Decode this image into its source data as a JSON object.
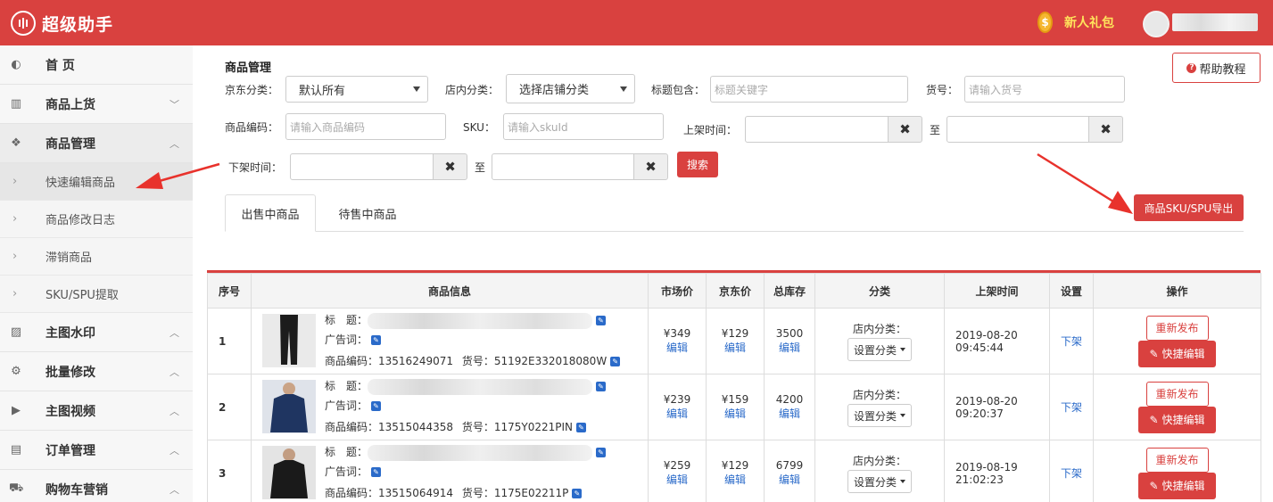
{
  "header": {
    "app_title": "超级助手",
    "gift_label": "新人礼包",
    "coin_symbol": "$"
  },
  "sidebar": {
    "items": [
      {
        "label": "首 页",
        "icon": "dashboard-icon",
        "glyph": "◐"
      },
      {
        "label": "商品上货",
        "icon": "columns-icon",
        "glyph": "▥"
      },
      {
        "label": "商品管理",
        "icon": "dropbox-icon",
        "glyph": "❖"
      },
      {
        "label": "主图水印",
        "icon": "image-icon",
        "glyph": "▨"
      },
      {
        "label": "批量修改",
        "icon": "cogs-icon",
        "glyph": "⚙"
      },
      {
        "label": "主图视频",
        "icon": "play-icon",
        "glyph": "▶"
      },
      {
        "label": "订单管理",
        "icon": "file-icon",
        "glyph": "▤"
      },
      {
        "label": "购物车营销",
        "icon": "cart-icon",
        "glyph": "⛟"
      }
    ],
    "sub_items": [
      {
        "label": "快速编辑商品"
      },
      {
        "label": "商品修改日志"
      },
      {
        "label": "滞销商品"
      },
      {
        "label": "SKU/SPU提取"
      }
    ]
  },
  "filters": {
    "title": "商品管理",
    "jd_category_label": "京东分类：",
    "jd_category_value": "默认所有",
    "shop_category_label": "店内分类：",
    "shop_category_value": "选择店铺分类",
    "title_contains_label": "标题包含：",
    "title_contains_placeholder": "标题关键字",
    "item_no_label": "货号：",
    "item_no_placeholder": "请输入货号",
    "code_label": "商品编码：",
    "code_placeholder": "请输入商品编码",
    "sku_label": "SKU：",
    "sku_placeholder": "请输入skuId",
    "on_shelf_label": "上架时间：",
    "off_shelf_label": "下架时间：",
    "to_label": "至",
    "search_button": "搜索",
    "help_button": "帮助教程",
    "export_button": "商品SKU/SPU导出"
  },
  "tabs": [
    {
      "label": "出售中商品"
    },
    {
      "label": "待售中商品"
    }
  ],
  "table": {
    "headers": [
      "序号",
      "商品信息",
      "市场价",
      "京东价",
      "总库存",
      "分类",
      "上架时间",
      "设置",
      "操作"
    ],
    "field_labels": {
      "title": "标　题：",
      "ad": "广告词：",
      "code": "商品编码：",
      "item_no": "货号："
    },
    "edit_label": "编辑",
    "shop_cat_label": "店内分类：",
    "set_cat_label": "设置分类",
    "off_label": "下架",
    "republish_label": "重新发布",
    "quick_edit_label": "快捷编辑",
    "rows": [
      {
        "seq": "1",
        "code": "13516249071",
        "item_no": "51192E332018080W",
        "market_price": "¥349",
        "jd_price": "¥129",
        "stock": "3500",
        "date": "2019-08-20",
        "time": "09:45:44"
      },
      {
        "seq": "2",
        "code": "13515044358",
        "item_no": "1175Y0221PIN",
        "market_price": "¥239",
        "jd_price": "¥159",
        "stock": "4200",
        "date": "2019-08-20",
        "time": "09:20:37"
      },
      {
        "seq": "3",
        "code": "13515064914",
        "item_no": "1175E02211P",
        "market_price": "¥259",
        "jd_price": "¥129",
        "stock": "6799",
        "date": "2019-08-19",
        "time": "21:02:23"
      }
    ]
  },
  "colors": {
    "brand_red": "#d9413f",
    "link_blue": "#2a6ac9",
    "gift_yellow": "#ffe45c"
  }
}
